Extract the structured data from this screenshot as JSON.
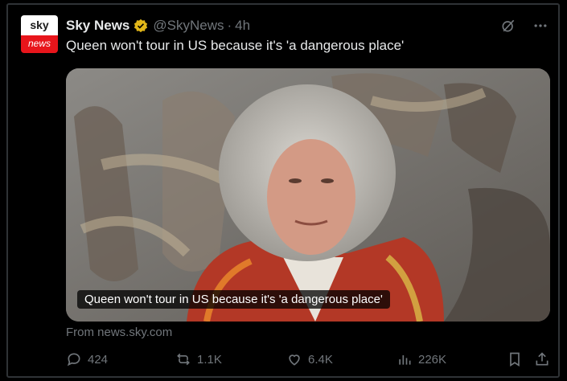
{
  "account": {
    "name": "Sky News",
    "handle": "@SkyNews",
    "separator": "·",
    "time": "4h",
    "avatar_top": "sky",
    "avatar_bottom": "news",
    "badge_color": "#e2b719"
  },
  "tweet": {
    "text": "Queen won't tour in US because it's 'a dangerous place'"
  },
  "media": {
    "caption": "Queen won't tour in US because it's 'a dangerous place'"
  },
  "link_source": "From news.sky.com",
  "actions": {
    "replies": "424",
    "reposts": "1.1K",
    "likes": "6.4K",
    "views": "226K"
  },
  "icons": [
    "grok-icon",
    "more-icon",
    "reply-icon",
    "repost-icon",
    "like-icon",
    "views-icon",
    "bookmark-icon",
    "share-icon"
  ]
}
